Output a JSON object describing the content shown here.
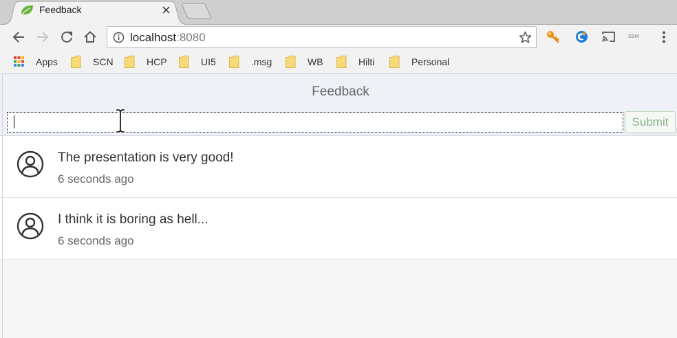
{
  "browser": {
    "tab": {
      "title": "Feedback",
      "favicon": "spring-leaf-icon",
      "close_icon": "close-icon"
    },
    "address": {
      "host": "localhost",
      "port": ":8080",
      "icon": "info-icon"
    },
    "toolbar_icons": [
      "back-arrow-icon",
      "forward-arrow-icon",
      "reload-icon",
      "home-icon",
      "star-icon",
      "key-icon",
      "globe-icon",
      "cast-icon",
      "menu-dots-icon"
    ],
    "extension_label": "SBM",
    "bookmarks": [
      {
        "label": "Apps",
        "icon": "apps-grid-icon"
      },
      {
        "label": "SCN",
        "icon": "folder-icon"
      },
      {
        "label": "HCP",
        "icon": "folder-icon"
      },
      {
        "label": "UI5",
        "icon": "folder-icon"
      },
      {
        "label": ".msg",
        "icon": "folder-icon"
      },
      {
        "label": "WB",
        "icon": "folder-icon"
      },
      {
        "label": "Hilti",
        "icon": "folder-icon"
      },
      {
        "label": "Personal",
        "icon": "folder-icon"
      }
    ]
  },
  "page": {
    "title": "Feedback",
    "feedback_input": {
      "value": ""
    },
    "submit": {
      "label": "Submit",
      "disabled": true
    },
    "feed": [
      {
        "text": "The presentation is very good!",
        "timestamp": "6 seconds ago",
        "icon": "person-icon"
      },
      {
        "text": "I think it is boring as hell...",
        "timestamp": "6 seconds ago",
        "icon": "person-icon"
      }
    ]
  },
  "colors": {
    "favicon_leaf": "#6db33f",
    "page_header_background": "#eef2f6",
    "submit_text": "#8ab58a",
    "list_background": "#ffffff",
    "page_background": "#f7f7f7"
  }
}
